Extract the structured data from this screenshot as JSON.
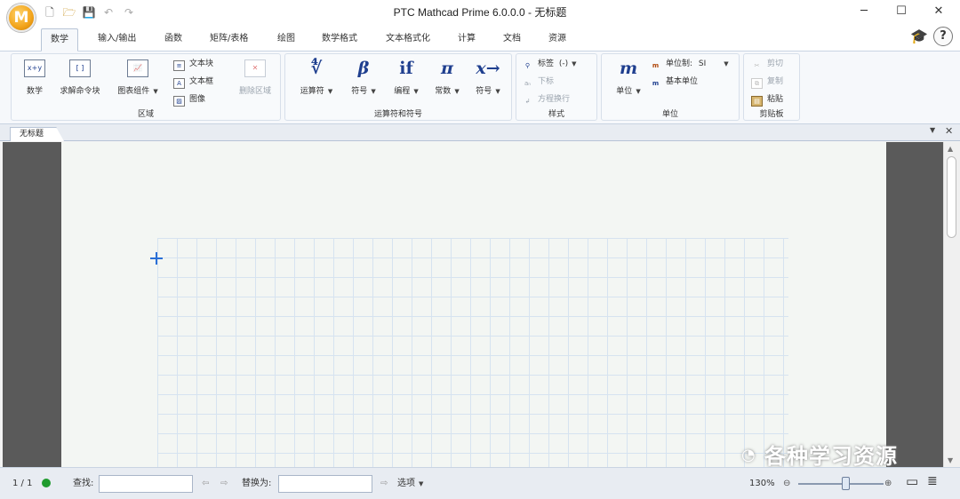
{
  "window": {
    "title": "PTC Mathcad Prime 6.0.0.0 - 无标题",
    "logo_letter": "M"
  },
  "tabs": [
    {
      "label": "数学",
      "active": true
    },
    {
      "label": "输入/输出"
    },
    {
      "label": "函数"
    },
    {
      "label": "矩阵/表格"
    },
    {
      "label": "绘图"
    },
    {
      "label": "数学格式"
    },
    {
      "label": "文本格式化"
    },
    {
      "label": "计算"
    },
    {
      "label": "文档"
    },
    {
      "label": "资源"
    }
  ],
  "help_label": "?",
  "ribbon": {
    "region": {
      "label": "区域",
      "math": "数学",
      "math_icon": "x+y",
      "solve": "求解命令块",
      "solve_icon": "[ ]",
      "chart": "图表组件",
      "textblock": "文本块",
      "textbox": "文本框",
      "image": "图像",
      "delete": "删除区域"
    },
    "operators": {
      "label": "运算符和符号",
      "op": "运算符",
      "op_icon": "∜",
      "sym": "符号",
      "sym_icon": "β",
      "prog": "编程",
      "prog_icon": "if",
      "const": "常数",
      "const_icon": "π",
      "sym2": "符号",
      "sym2_icon": "x→"
    },
    "style": {
      "label": "样式",
      "tag": "标签",
      "tag_value": "(-)",
      "subscript": "下标",
      "eq_break": "方程换行"
    },
    "units": {
      "label": "单位",
      "unit": "单位",
      "unit_icon": "m",
      "unit_system": "单位制:",
      "unit_system_value": "SI",
      "base_unit": "基本单位"
    },
    "clipboard": {
      "label": "剪贴板",
      "cut": "剪切",
      "copy": "复制",
      "paste": "粘贴"
    }
  },
  "document": {
    "tab_name": "无标题"
  },
  "statusbar": {
    "page": "1 / 1",
    "find_label": "查找:",
    "find_value": "",
    "replace_label": "替换为:",
    "replace_value": "",
    "options": "选项",
    "zoom": "130%"
  },
  "watermark": "各种学习资源",
  "colors": {
    "accent": "#1f3f8f",
    "status_ok": "#1f9b2e",
    "grid_line": "#d6e3f0"
  }
}
